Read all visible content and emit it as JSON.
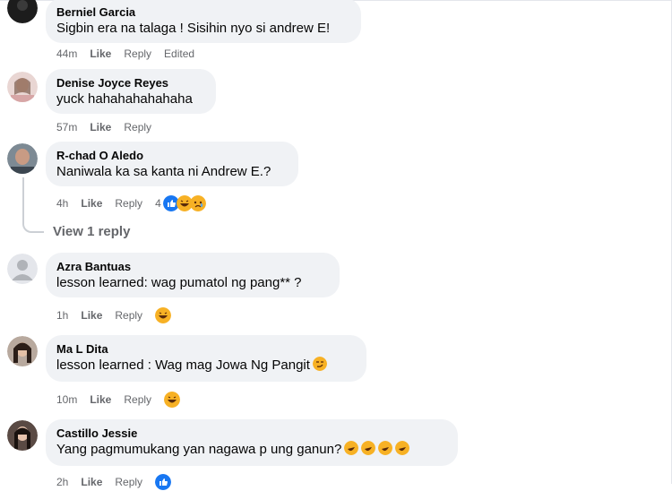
{
  "comments": [
    {
      "author": "Berniel Garcia",
      "text": "Sigbin era na talaga ! Sisihin nyo si andrew E!",
      "time": "44m",
      "like": "Like",
      "reply": "Reply",
      "extra": "Edited",
      "avatar_icon": "avatar-dark-icon"
    },
    {
      "author": "Denise Joyce Reyes",
      "text": "yuck hahahahahahaha",
      "time": "57m",
      "like": "Like",
      "reply": "Reply",
      "avatar_icon": "avatar-photo-icon"
    },
    {
      "author": "R-chad O Aledo",
      "text": "Naniwala ka sa kanta ni Andrew E.?",
      "time": "4h",
      "like": "Like",
      "reply": "Reply",
      "reaction_count": "4",
      "reactions": [
        "like-reaction-icon",
        "haha-reaction-icon",
        "sad-reaction-icon"
      ],
      "avatar_icon": "avatar-photo-icon"
    },
    {
      "author": "Azra Bantuas",
      "text": "lesson learned: wag pumatol ng pang** ?",
      "time": "1h",
      "like": "Like",
      "reply": "Reply",
      "reactions": [
        "haha-reaction-icon"
      ],
      "avatar_icon": "avatar-default-icon"
    },
    {
      "author": "Ma L Dita",
      "text": "lesson learned : Wag mag Jowa Ng Pangit",
      "time": "10m",
      "like": "Like",
      "reply": "Reply",
      "reactions": [
        "haha-reaction-icon"
      ],
      "avatar_icon": "avatar-photo-icon"
    },
    {
      "author": "Castillo Jessie",
      "text": "Yang pagmumukang yan nagawa p ung ganun?",
      "time": "2h",
      "like": "Like",
      "reply": "Reply",
      "reactions": [
        "like-reaction-icon"
      ],
      "avatar_icon": "avatar-photo-icon"
    }
  ],
  "view_replies": "View 1 reply",
  "colors": {
    "bubble": "#f0f2f5",
    "meta_text": "#65676b",
    "like_blue": "#1877f2",
    "haha_yellow": "#f7b125"
  }
}
